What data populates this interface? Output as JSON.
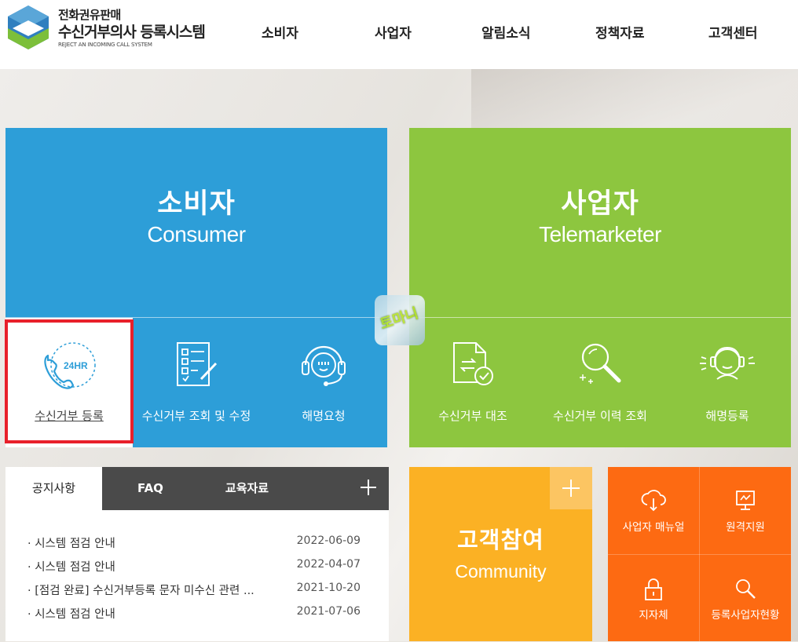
{
  "logo": {
    "line1": "전화권유판매",
    "line2": "수신거부의사 등록시스템",
    "sub": "REJECT AN INCOMING CALL SYSTEM"
  },
  "nav": [
    {
      "label": "소비자"
    },
    {
      "label": "사업자"
    },
    {
      "label": "알림소식"
    },
    {
      "label": "정책자료"
    },
    {
      "label": "고객센터"
    }
  ],
  "consumer": {
    "title_ko": "소비자",
    "title_en": "Consumer",
    "items": [
      {
        "label": "수신거부 등록",
        "icon": "24hr-phone-icon"
      },
      {
        "label": "수신거부 조회 및 수정",
        "icon": "checklist-icon"
      },
      {
        "label": "해명요청",
        "icon": "headset-icon"
      }
    ]
  },
  "telemarketer": {
    "title_ko": "사업자",
    "title_en": "Telemarketer",
    "items": [
      {
        "label": "수신거부 대조",
        "icon": "document-compare-icon"
      },
      {
        "label": "수신거부 이력 조회",
        "icon": "magnifier-icon"
      },
      {
        "label": "해명등록",
        "icon": "operator-icon"
      }
    ]
  },
  "watermark": {
    "text": "토마니"
  },
  "notice": {
    "tabs": [
      {
        "label": "공지사항"
      },
      {
        "label": "FAQ"
      },
      {
        "label": "교육자료"
      }
    ],
    "items": [
      {
        "title": "· 시스템 점검 안내",
        "date": "2022-06-09"
      },
      {
        "title": "· 시스템 점검 안내",
        "date": "2022-04-07"
      },
      {
        "title": "· [점검 완료] 수신거부등록 문자 미수신 관련 ...",
        "date": "2021-10-20"
      },
      {
        "title": "· 시스템 점검 안내",
        "date": "2021-07-06"
      }
    ]
  },
  "community": {
    "title_ko": "고객참여",
    "title_en": "Community"
  },
  "quick": [
    {
      "label": "사업자 매뉴얼",
      "icon": "cloud-download-icon"
    },
    {
      "label": "원격지원",
      "icon": "monitor-icon"
    },
    {
      "label": "지자체",
      "icon": "lock-icon"
    },
    {
      "label": "등록사업자현황",
      "icon": "search-icon"
    }
  ],
  "colors": {
    "consumer": "#2d9ed8",
    "telemarketer": "#8dc63f",
    "community": "#fbb124",
    "quick": "#fd6a12",
    "highlight": "#e8202a"
  }
}
